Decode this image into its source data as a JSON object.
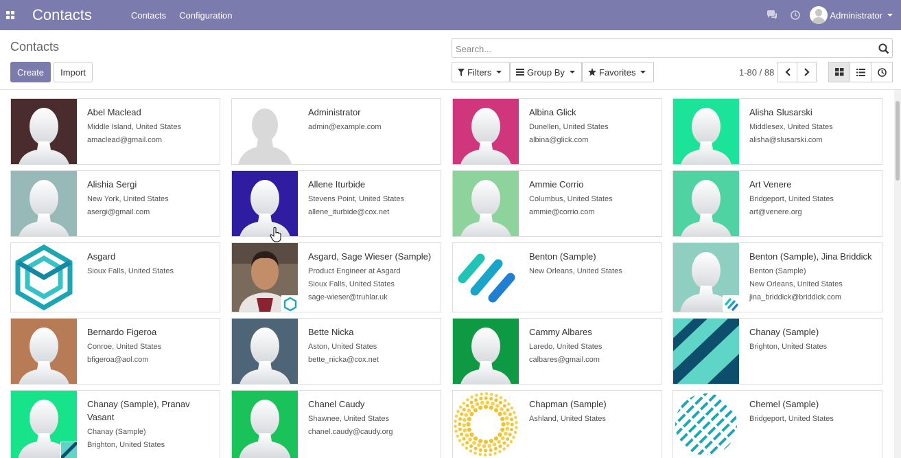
{
  "navbar": {
    "app_title": "Contacts",
    "menu": [
      "Contacts",
      "Configuration"
    ],
    "user_name": "Administrator"
  },
  "control_panel": {
    "title": "Contacts",
    "create_label": "Create",
    "import_label": "Import",
    "search_placeholder": "Search...",
    "filters_label": "Filters",
    "group_by_label": "Group By",
    "favorites_label": "Favorites",
    "pager": "1-80 / 88",
    "views": [
      "kanban",
      "list",
      "activity"
    ],
    "active_view": "kanban"
  },
  "colors": {
    "navbar": "#7c7bad",
    "primary": "#7c7bad"
  },
  "contacts": [
    {
      "name": "Abel Maclead",
      "lines": [
        "Middle Island, United States",
        "amaclead@gmail.com"
      ],
      "avatar": "person",
      "bg": "#4a2b2e"
    },
    {
      "name": "Administrator",
      "lines": [
        "admin@example.com"
      ],
      "avatar": "placeholder",
      "bg": "#ffffff"
    },
    {
      "name": "Albina Glick",
      "lines": [
        "Dunellen, United States",
        "albina@glick.com"
      ],
      "avatar": "person",
      "bg": "#d0367c"
    },
    {
      "name": "Alisha Slusarski",
      "lines": [
        "Middlesex, United States",
        "alisha@slusarski.com"
      ],
      "avatar": "person",
      "bg": "#1be39a"
    },
    {
      "name": "Alishia Sergi",
      "lines": [
        "New York, United States",
        "asergi@gmail.com"
      ],
      "avatar": "person",
      "bg": "#97b9b7"
    },
    {
      "name": "Allene Iturbide",
      "lines": [
        "Stevens Point, United States",
        "allene_iturbide@cox.net"
      ],
      "avatar": "person",
      "bg": "#2e1da0"
    },
    {
      "name": "Ammie Corrio",
      "lines": [
        "Columbus, United States",
        "ammie@corrio.com"
      ],
      "avatar": "person",
      "bg": "#8fd39c"
    },
    {
      "name": "Art Venere",
      "lines": [
        "Bridgeport, United States",
        "art@venere.org"
      ],
      "avatar": "person",
      "bg": "#4fd3a2"
    },
    {
      "name": "Asgard",
      "lines": [
        "Sioux Falls, United States"
      ],
      "avatar": "logo-hex",
      "bg": "#ffffff"
    },
    {
      "name": "Asgard, Sage Wieser (Sample)",
      "lines": [
        "Product Engineer at Asgard",
        "Sioux Falls, United States",
        "sage-wieser@truhlar.uk"
      ],
      "avatar": "photo",
      "bg": "#6a5a4e"
    },
    {
      "name": "Benton (Sample)",
      "lines": [
        "New Orleans, United States"
      ],
      "avatar": "logo-stripes",
      "bg": "#ffffff"
    },
    {
      "name": "Benton (Sample), Jina Briddick",
      "lines": [
        "Benton (Sample)",
        "New Orleans, United States",
        "jina_briddick@briddick.com"
      ],
      "avatar": "person",
      "bg": "#8fcfc2"
    },
    {
      "name": "Bernardo Figeroa",
      "lines": [
        "Conroe, United States",
        "bfigeroa@aol.com"
      ],
      "avatar": "person",
      "bg": "#b77b55"
    },
    {
      "name": "Bette Nicka",
      "lines": [
        "Aston, United States",
        "bette_nicka@cox.net"
      ],
      "avatar": "person",
      "bg": "#4d6577"
    },
    {
      "name": "Cammy Albares",
      "lines": [
        "Laredo, United States",
        "calbares@gmail.com"
      ],
      "avatar": "person",
      "bg": "#0e9a43"
    },
    {
      "name": "Chanay (Sample)",
      "lines": [
        "Brighton, United States"
      ],
      "avatar": "logo-diagonal",
      "bg": "#5fd5c8"
    },
    {
      "name": "Chanay (Sample), Pranav Vasant",
      "lines": [
        "Chanay (Sample)",
        "Brighton, United States"
      ],
      "avatar": "person",
      "bg": "#17e48a"
    },
    {
      "name": "Chanel Caudy",
      "lines": [
        "Shawnee, United States",
        "chanel.caudy@caudy.org"
      ],
      "avatar": "person",
      "bg": "#19c35a"
    },
    {
      "name": "Chapman (Sample)",
      "lines": [
        "Ashland, United States"
      ],
      "avatar": "logo-sun",
      "bg": "#ffffff"
    },
    {
      "name": "Chemel (Sample)",
      "lines": [
        "Bridgeport, United States"
      ],
      "avatar": "logo-circle",
      "bg": "#ffffff"
    }
  ]
}
